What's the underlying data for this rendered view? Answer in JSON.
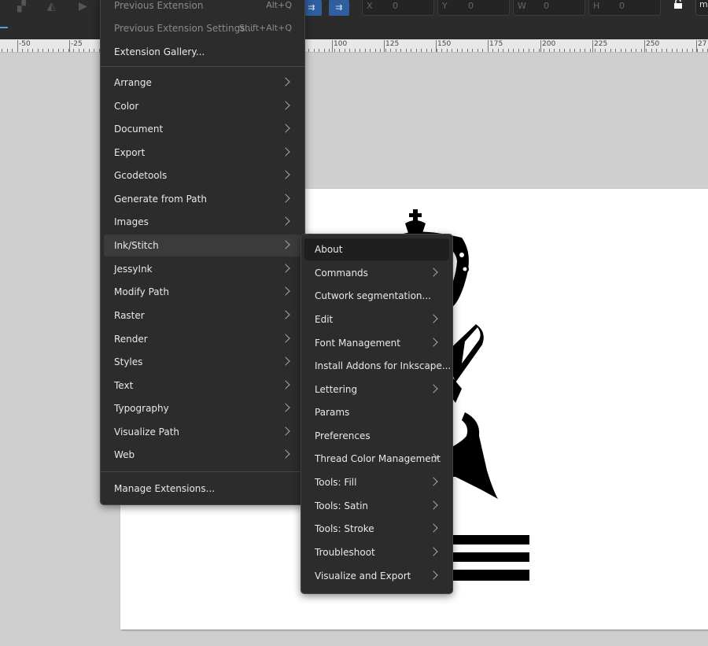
{
  "toolbar": {
    "fields": [
      {
        "label": "X",
        "value": "0"
      },
      {
        "label": "Y",
        "value": "0"
      },
      {
        "label": "W",
        "value": "0"
      },
      {
        "label": "H",
        "value": "0"
      }
    ],
    "unit": "m"
  },
  "ruler": {
    "labels": [
      "-50",
      "-25",
      "100",
      "125",
      "150",
      "175",
      "200",
      "225",
      "250",
      "27"
    ]
  },
  "extensions_menu": {
    "top_items": [
      {
        "label": "Previous Extension",
        "shortcut": "Alt+Q"
      },
      {
        "label": "Previous Extension Settings...",
        "shortcut": "Shift+Alt+Q"
      },
      {
        "label": "Extension Gallery...",
        "shortcut": ""
      }
    ],
    "submenus": [
      "Arrange",
      "Color",
      "Document",
      "Export",
      "Gcodetools",
      "Generate from Path",
      "Images",
      "Ink/Stitch",
      "JessyInk",
      "Modify Path",
      "Raster",
      "Render",
      "Styles",
      "Text",
      "Typography",
      "Visualize Path",
      "Web"
    ],
    "bottom_item": "Manage Extensions..."
  },
  "inkstitch_menu": {
    "items": [
      {
        "label": "About",
        "submenu": false
      },
      {
        "label": "Commands",
        "submenu": true
      },
      {
        "label": "Cutwork segmentation...",
        "submenu": false
      },
      {
        "label": "Edit",
        "submenu": true
      },
      {
        "label": "Font Management",
        "submenu": true
      },
      {
        "label": "Install Addons for Inkscape...",
        "submenu": false
      },
      {
        "label": "Lettering",
        "submenu": true
      },
      {
        "label": "Params",
        "submenu": false
      },
      {
        "label": "Preferences",
        "submenu": false
      },
      {
        "label": "Thread Color Management",
        "submenu": true
      },
      {
        "label": "Tools: Fill",
        "submenu": true
      },
      {
        "label": "Tools: Satin",
        "submenu": true
      },
      {
        "label": "Tools: Stroke",
        "submenu": true
      },
      {
        "label": "Troubleshoot",
        "submenu": true
      },
      {
        "label": "Visualize and Export",
        "submenu": true
      }
    ]
  },
  "colors": {
    "menu_bg": "#2c2c2c",
    "canvas_bg": "#cfcfcf",
    "toolbar_bg": "#2b2b2b",
    "accent": "#2f5f9f"
  }
}
